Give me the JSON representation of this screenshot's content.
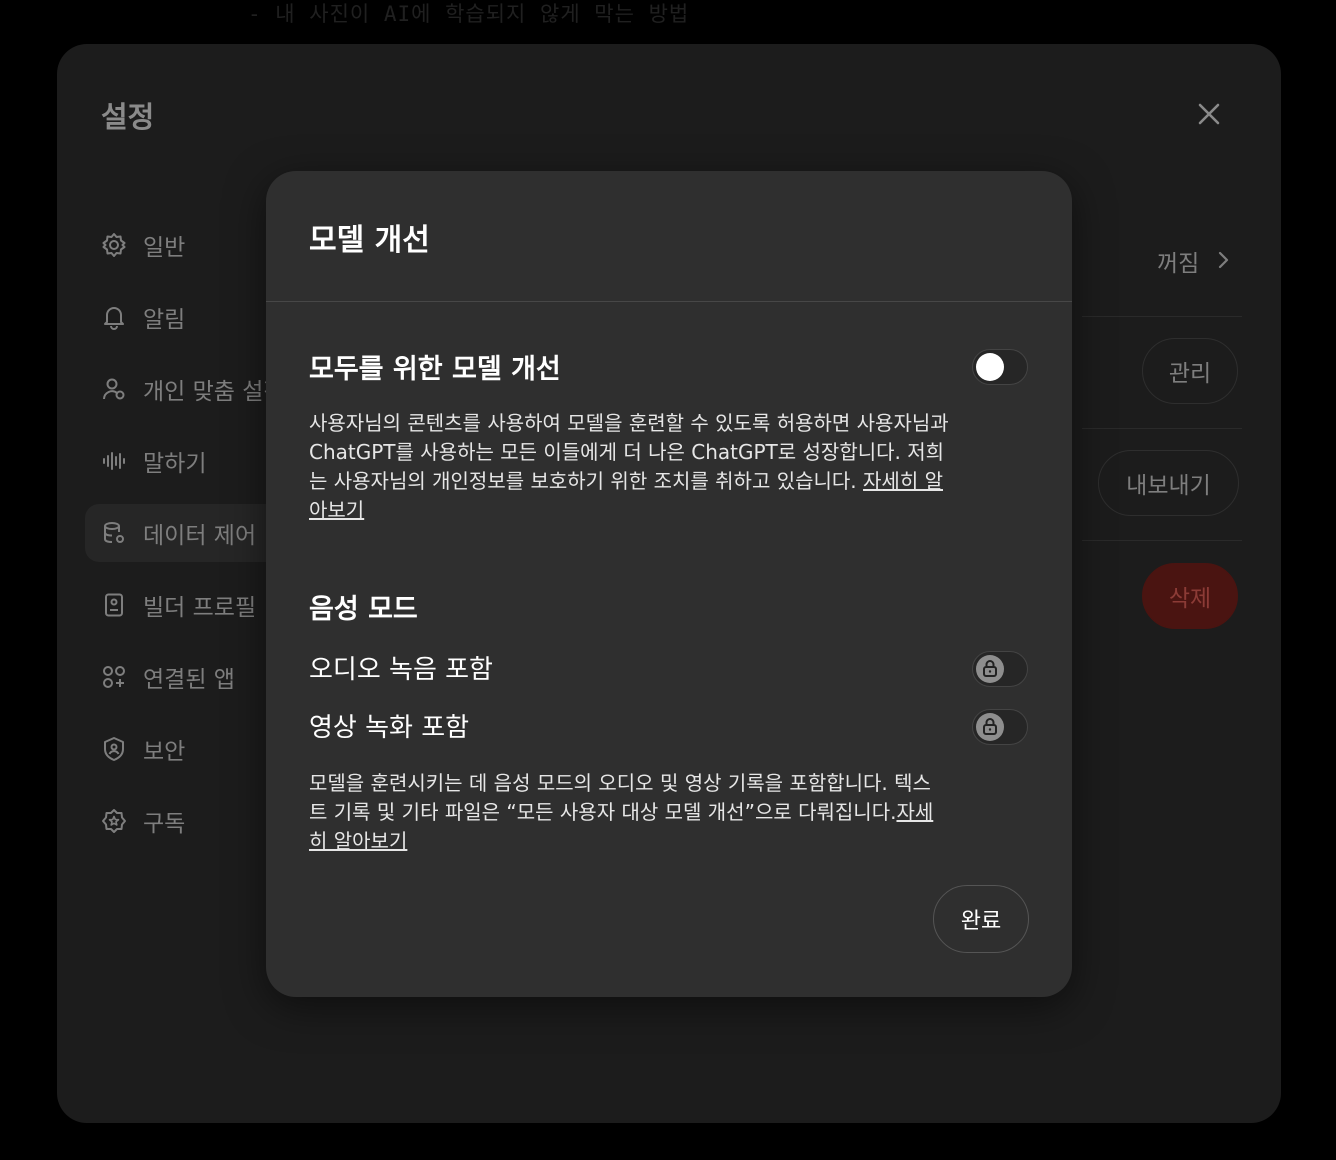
{
  "background": {
    "page_text": "- 내 사진이 AI에 학습되지 않게 막는 방법"
  },
  "settings": {
    "title": "설정",
    "close_icon": "close-icon",
    "nav": [
      {
        "label": "일반",
        "icon": "gear-icon"
      },
      {
        "label": "알림",
        "icon": "bell-icon"
      },
      {
        "label": "개인 맞춤 설정",
        "icon": "person-icon"
      },
      {
        "label": "말하기",
        "icon": "waveform-icon"
      },
      {
        "label": "데이터 제어",
        "icon": "database-icon"
      },
      {
        "label": "빌더 프로필",
        "icon": "id-card-icon"
      },
      {
        "label": "연결된 앱",
        "icon": "apps-icon"
      },
      {
        "label": "보안",
        "icon": "shield-icon"
      },
      {
        "label": "구독",
        "icon": "badge-icon"
      }
    ],
    "rows": {
      "status_value": "꺼짐",
      "manage_label": "관리",
      "export_label": "내보내기",
      "delete_label": "삭제"
    }
  },
  "modal": {
    "title": "모델 개선",
    "everyone": {
      "label": "모두를 위한 모델 개선",
      "enabled": false,
      "desc_text": "사용자님의 콘텐츠를 사용하여 모델을 훈련할 수 있도록 허용하면 사용자님과 ChatGPT를 사용하는 모든 이들에게 더 나은 ChatGPT로 성장합니다. 저희는 사용자님의 개인정보를 보호하기 위한 조치를 취하고 있습니다. ",
      "link": "자세히 알아보기"
    },
    "voice": {
      "heading": "음성 모드",
      "audio_label": "오디오 녹음 포함",
      "video_label": "영상 녹화 포함",
      "desc_text": "모델을 훈련시키는 데 음성 모드의 오디오 및 영상 기록을 포함합니다. 텍스트 기록 및 기타 파일은 “모든 사용자 대상 모델 개선”으로 다뤄집니다.",
      "link": "자세히 알아보기"
    },
    "done_label": "완료"
  }
}
